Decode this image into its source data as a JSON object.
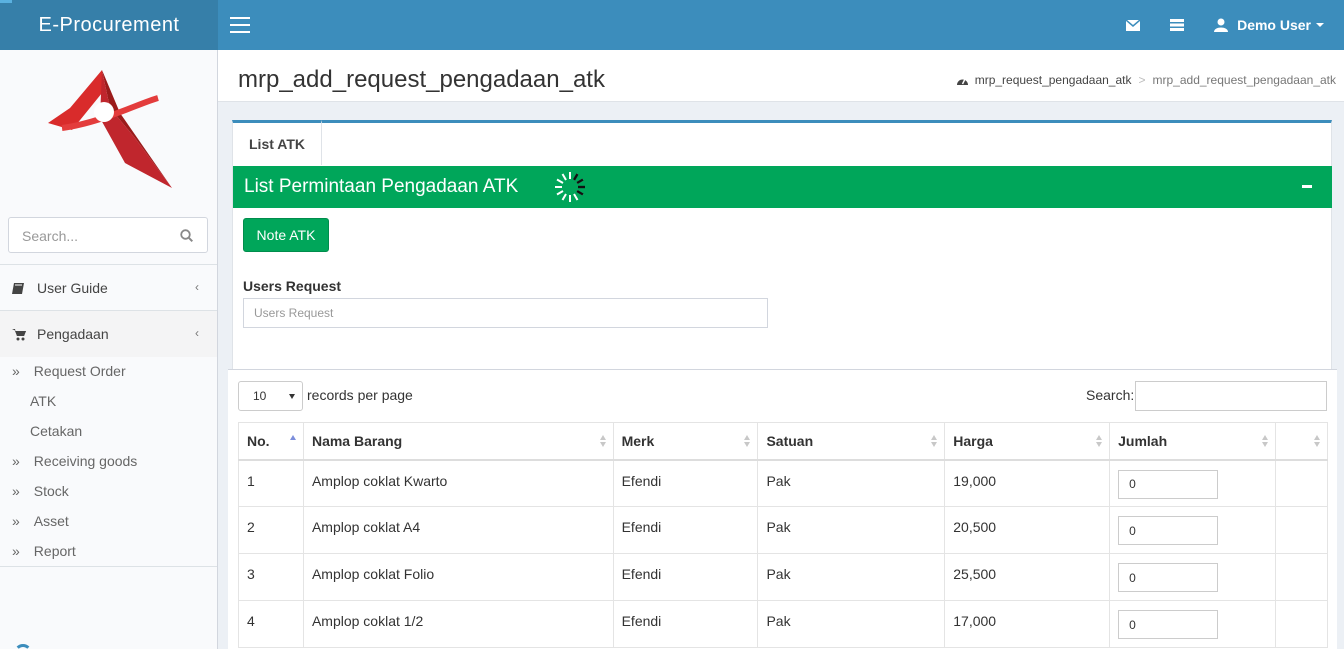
{
  "app": {
    "title": "E-Procurement"
  },
  "topbar": {
    "user_name": "Demo User"
  },
  "sidebar": {
    "search_placeholder": "Search...",
    "menu": [
      {
        "label": "User Guide"
      },
      {
        "label": "Pengadaan"
      }
    ],
    "submenu": [
      {
        "label": "Request Order",
        "style": "arrow"
      },
      {
        "label": "ATK",
        "style": "plain"
      },
      {
        "label": "Cetakan",
        "style": "plain"
      },
      {
        "label": "Receiving goods",
        "style": "arrow"
      },
      {
        "label": "Stock",
        "style": "arrow"
      },
      {
        "label": "Asset",
        "style": "arrow"
      },
      {
        "label": "Report",
        "style": "arrow"
      }
    ]
  },
  "header": {
    "page_title": "mrp_add_request_pengadaan_atk",
    "breadcrumb": [
      "mrp_request_pengadaan_atk",
      "mrp_add_request_pengadaan_atk"
    ]
  },
  "box": {
    "tab_label": "List ATK",
    "panel_title": "List Permintaan Pengadaan ATK",
    "note_button": "Note ATK",
    "users_label": "Users Request",
    "users_placeholder": "Users Request"
  },
  "table": {
    "length_value": "10",
    "length_label": "records per page",
    "search_label": "Search:",
    "columns": [
      "No.",
      "Nama Barang",
      "Merk",
      "Satuan",
      "Harga",
      "Jumlah",
      ""
    ],
    "rows": [
      {
        "no": "1",
        "nama": "Amplop coklat Kwarto",
        "merk": "Efendi",
        "satuan": "Pak",
        "harga": "19,000",
        "jumlah": "0"
      },
      {
        "no": "2",
        "nama": "Amplop coklat A4",
        "merk": "Efendi",
        "satuan": "Pak",
        "harga": "20,500",
        "jumlah": "0"
      },
      {
        "no": "3",
        "nama": "Amplop coklat Folio",
        "merk": "Efendi",
        "satuan": "Pak",
        "harga": "25,500",
        "jumlah": "0"
      },
      {
        "no": "4",
        "nama": "Amplop coklat 1/2",
        "merk": "Efendi",
        "satuan": "Pak",
        "harga": "17,000",
        "jumlah": "0"
      }
    ]
  },
  "colors": {
    "header": "#3c8dbc",
    "logo_bar": "#367fa9",
    "success": "#00a65a"
  }
}
